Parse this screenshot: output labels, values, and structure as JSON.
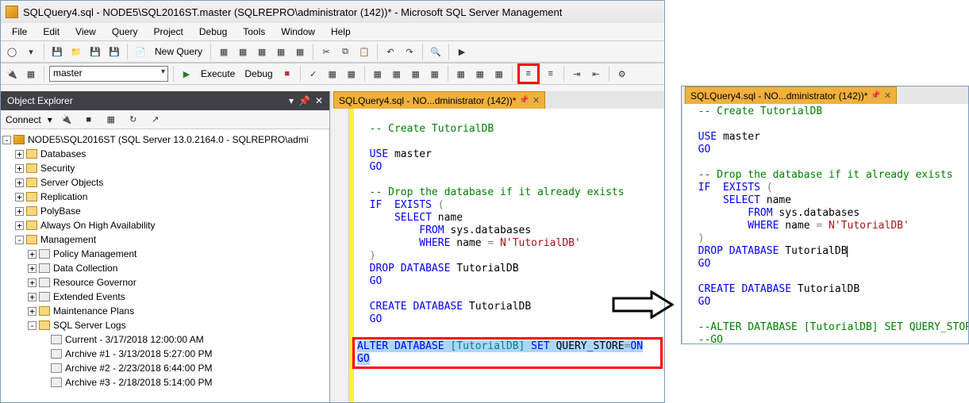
{
  "title": "SQLQuery4.sql - NODE5\\SQL2016ST.master (SQLREPRO\\administrator (142))* - Microsoft SQL Server Management",
  "menus": [
    "File",
    "Edit",
    "View",
    "Query",
    "Project",
    "Debug",
    "Tools",
    "Window",
    "Help"
  ],
  "toolbar1": {
    "newquery": "New Query"
  },
  "toolbar2": {
    "db": "master",
    "execute": "Execute",
    "debug": "Debug"
  },
  "objexp": {
    "title": "Object Explorer",
    "connect": "Connect",
    "server": "NODE5\\SQL2016ST (SQL Server 13.0.2164.0 - SQLREPRO\\admi",
    "top": [
      "Databases",
      "Security",
      "Server Objects",
      "Replication",
      "PolyBase",
      "Always On High Availability"
    ],
    "mgmt": "Management",
    "mgmt_children": [
      "Policy Management",
      "Data Collection",
      "Resource Governor",
      "Extended Events",
      "Maintenance Plans"
    ],
    "logs": "SQL Server Logs",
    "log_items": [
      "Current - 3/17/2018 12:00:00 AM",
      "Archive #1 - 3/13/2018 5:27:00 PM",
      "Archive #2 - 2/23/2018 6:44:00 PM",
      "Archive #3 - 2/18/2018 5:14:00 PM"
    ]
  },
  "tab": "SQLQuery4.sql - NO...dministrator (142))*",
  "code_left": {
    "l1": "",
    "l2": "-- Create TutorialDB",
    "l3": "",
    "l4": "USE master",
    "l5": "GO",
    "l6": "",
    "l7": "-- Drop the database if it already exists",
    "l8": "IF  EXISTS (",
    "l9": "    SELECT name",
    "l10": "        FROM sys.databases",
    "l11": "        WHERE name = N'TutorialDB'",
    "l12": ")",
    "l13": "DROP DATABASE TutorialDB",
    "l14": "GO",
    "l15": "",
    "l16": "CREATE DATABASE TutorialDB",
    "l17": "GO",
    "l18": "",
    "l19": "ALTER DATABASE [TutorialDB] SET QUERY_STORE=ON",
    "l20": "GO"
  },
  "code_right": {
    "l1": "-- Create TutorialDB",
    "l2": "",
    "l3": "USE master",
    "l4": "GO",
    "l5": "",
    "l6": "-- Drop the database if it already exists",
    "l7": "IF  EXISTS (",
    "l8": "    SELECT name",
    "l9": "        FROM sys.databases",
    "l10": "        WHERE name = N'TutorialDB'",
    "l11": ")",
    "l12": "DROP DATABASE TutorialDB",
    "l13": "GO",
    "l14": "",
    "l15": "CREATE DATABASE TutorialDB",
    "l16": "GO",
    "l17": "",
    "l18": "--ALTER DATABASE [TutorialDB] SET QUERY_STORE=ON",
    "l19": "--GO"
  }
}
